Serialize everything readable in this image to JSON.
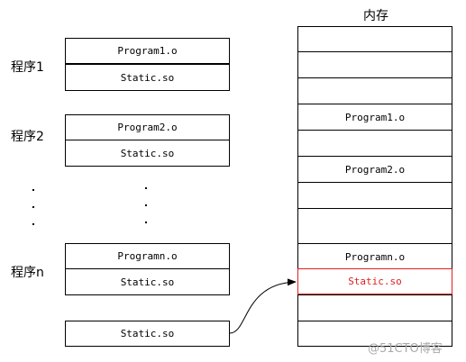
{
  "programs": [
    {
      "label": "程序1",
      "top_cell": "Program1.o",
      "bottom_cell": "Static.so"
    },
    {
      "label": "程序2",
      "top_cell": "Program2.o",
      "bottom_cell": "Static.so"
    },
    {
      "label": "程序n",
      "top_cell": "Programn.o",
      "bottom_cell": "Static.so"
    }
  ],
  "standalone_lib": "Static.so",
  "memory": {
    "title": "内存",
    "rows": [
      "",
      "",
      "",
      "Program1.o",
      "",
      "Program2.o",
      "",
      "",
      "Programn.o",
      "Static.so",
      "",
      ""
    ],
    "highlight_color": "#e02020"
  },
  "watermark": "@51CTO博客"
}
